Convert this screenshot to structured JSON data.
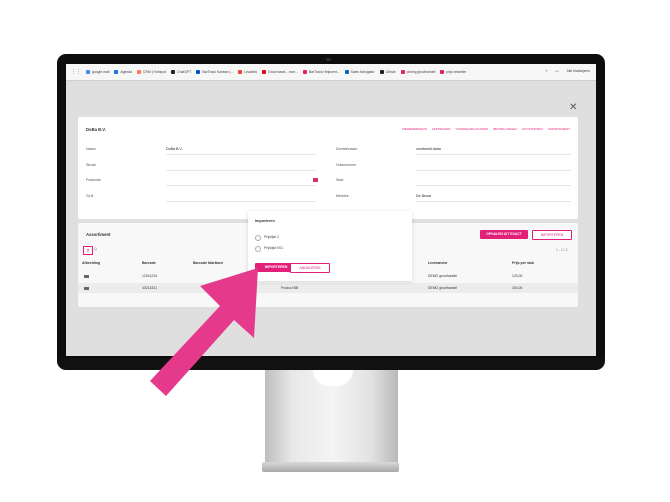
{
  "bookmarks": {
    "items": [
      {
        "label": "google.mail",
        "color": "#4285f4"
      },
      {
        "label": "Agenda",
        "color": "#1a73e8"
      },
      {
        "label": "CRM | Hubspot",
        "color": "#ff7a59"
      },
      {
        "label": "ChatGPT",
        "color": "#222222"
      },
      {
        "label": "BarTrack Kanban |...",
        "color": "#0052cc"
      },
      {
        "label": "Leadinfo",
        "color": "#e8453c"
      },
      {
        "label": "Exact basis - over...",
        "color": "#e4002b"
      },
      {
        "label": "BarTrack Helpcent...",
        "color": "#e2207a"
      },
      {
        "label": "Sales Navigator",
        "color": "#0a66c2"
      },
      {
        "label": "Github",
        "color": "#222222"
      },
      {
        "label": "pricing groothandel",
        "color": "#e2207a"
      },
      {
        "label": "prijs bestelier",
        "color": "#e2207a"
      }
    ],
    "more": "»",
    "all_bookmarks": "Alle bladwijzers"
  },
  "form": {
    "company": "DoBa B.V.",
    "tabs": [
      "MEDEWERKERS",
      "AFSPRAKEN",
      "VOORRAADLOCATIES",
      "BESTELLINGEN",
      "ACTIVITEITEN",
      "ASSORTIMENT"
    ],
    "fields": {
      "naam_label": "Naam",
      "naam_value": "DoBa B.V.",
      "straat_label": "Straat",
      "postcode_label": "Postcode",
      "gln_label": "GLN",
      "domeinnaam_label": "Domeinnaam",
      "domeinnaam_value": "voorbeeld.doba",
      "huisnummer_label": "Huisnummer",
      "stad_label": "Stad",
      "merkles_label": "Merkles",
      "merkles_value": "De Beuar"
    }
  },
  "assortiment": {
    "title": "Assortiment",
    "btn_exact": "OPHALEN UIT EXACT",
    "btn_import": "IMPORTEREN",
    "filter_icon": "filter-icon",
    "search_prefix": "Q",
    "pagination": "1 - 2 / 2",
    "columns": [
      "Afbeelding",
      "Barcode",
      "Barcode fabrikant",
      "Leverancier",
      "Prijs per stuk"
    ],
    "rows": [
      {
        "barcode": "12341234",
        "product": "",
        "supplier": "DEMO groothandel",
        "price": "120,00"
      },
      {
        "barcode": "43214321",
        "product": "Product BB",
        "supplier": "DEMO groothandel",
        "price": "160,00"
      }
    ]
  },
  "modal": {
    "title": "Importeren",
    "options": [
      "Prijslijst 2",
      "Prijslijst 001"
    ],
    "import_label": "IMPORTEREN",
    "cancel_label": "ANNULEREN"
  },
  "colors": {
    "accent": "#e2207a",
    "arrow": "#e5398b"
  }
}
